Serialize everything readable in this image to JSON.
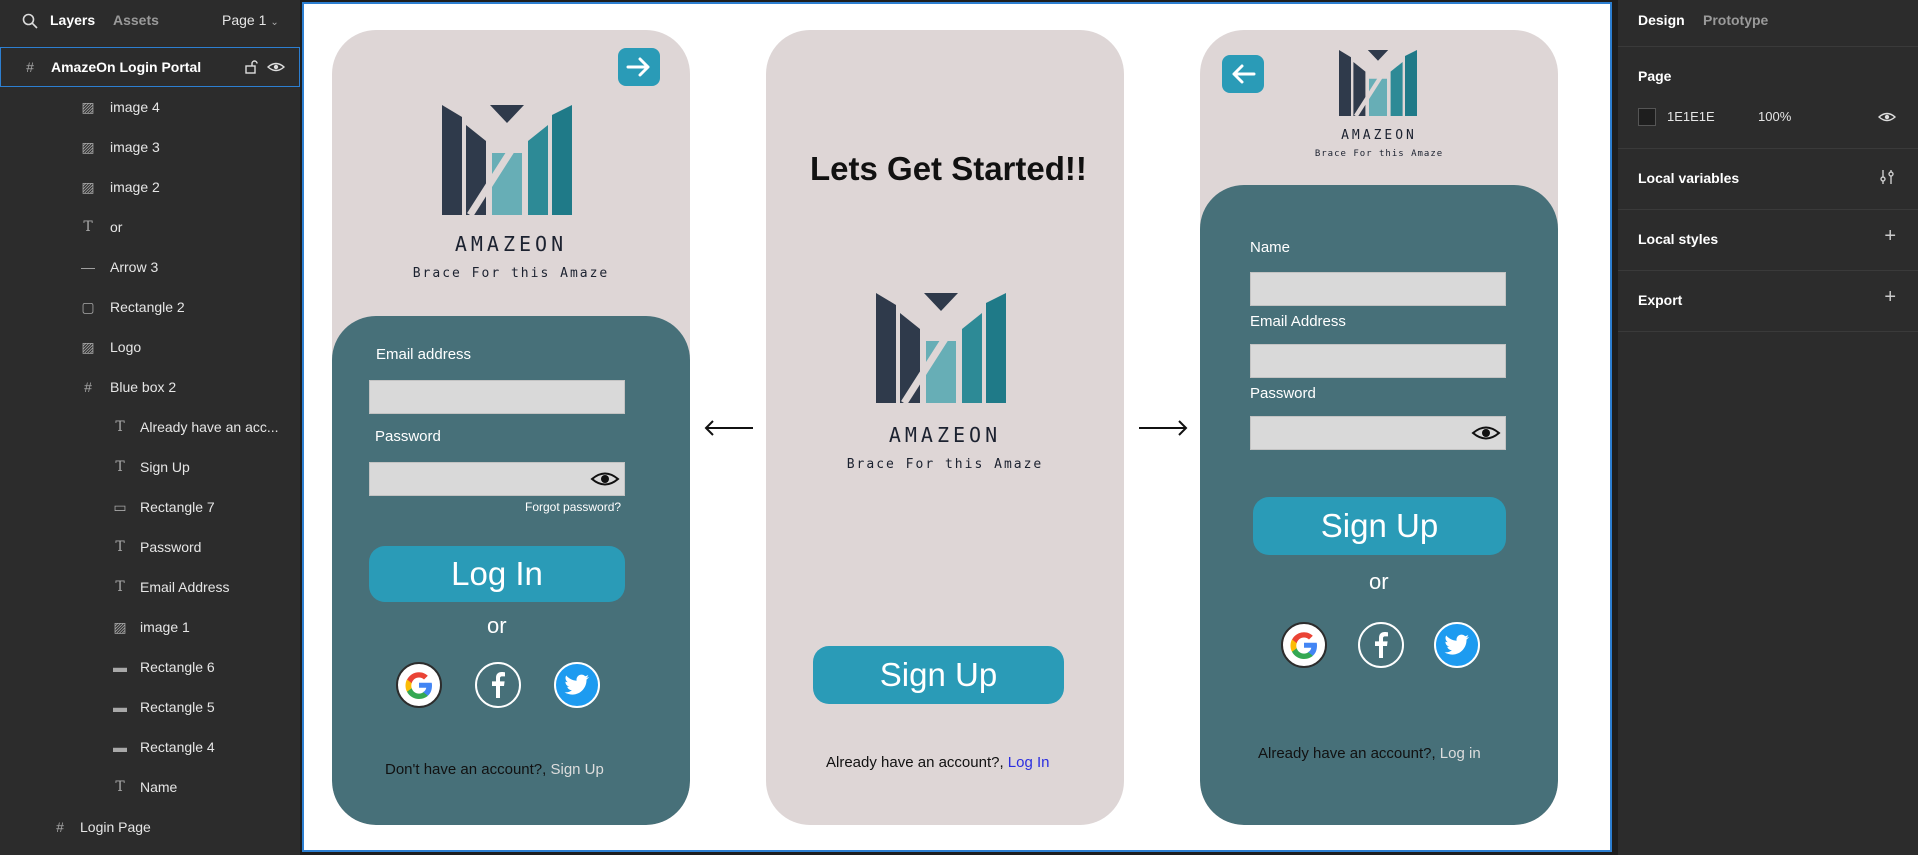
{
  "left_panel": {
    "tabs": {
      "layers": "Layers",
      "assets": "Assets"
    },
    "page_selector": "Page 1",
    "layers": [
      {
        "label": "AmazeOn Login Portal",
        "icon": "frame-icon",
        "selected": true
      },
      {
        "label": "image 4",
        "icon": "image-icon"
      },
      {
        "label": "image 3",
        "icon": "image-icon"
      },
      {
        "label": "image 2",
        "icon": "image-icon"
      },
      {
        "label": "or",
        "icon": "text-icon"
      },
      {
        "label": "Arrow 3",
        "icon": "line-icon"
      },
      {
        "label": "Rectangle 2",
        "icon": "rectangle-icon"
      },
      {
        "label": "Logo",
        "icon": "image-icon"
      },
      {
        "label": "Blue box 2",
        "icon": "frame-icon"
      },
      {
        "label": "Already have an acc...",
        "icon": "text-icon"
      },
      {
        "label": "Sign Up",
        "icon": "text-icon"
      },
      {
        "label": "Rectangle 7",
        "icon": "rectangle-icon"
      },
      {
        "label": "Password",
        "icon": "text-icon"
      },
      {
        "label": "Email Address",
        "icon": "text-icon"
      },
      {
        "label": "image 1",
        "icon": "image-icon"
      },
      {
        "label": "Rectangle 6",
        "icon": "rectangle-icon"
      },
      {
        "label": "Rectangle 5",
        "icon": "rectangle-icon"
      },
      {
        "label": "Rectangle 4",
        "icon": "rectangle-icon"
      },
      {
        "label": "Name",
        "icon": "text-icon"
      },
      {
        "label": "Login Page",
        "icon": "frame-icon"
      }
    ]
  },
  "canvas": {
    "logo": {
      "brand": "AMAZEON",
      "tagline": "Brace For this Amaze"
    },
    "login_screen": {
      "email_label": "Email address",
      "password_label": "Password",
      "forgot_password": "Forgot password?",
      "login_button": "Log In",
      "or_text": "or",
      "footer_prefix": "Don't have an account?,",
      "footer_link": "Sign Up"
    },
    "start_screen": {
      "headline": "Lets Get Started!!",
      "signup_button": "Sign Up",
      "footer_prefix": "Already have an account?,",
      "footer_link": "Log In"
    },
    "signup_screen": {
      "name_label": "Name",
      "email_label": "Email Address",
      "password_label": "Password",
      "signup_button": "Sign Up",
      "or_text": "or",
      "footer_prefix": "Already  have an account?,",
      "footer_link": "Log in"
    },
    "colors": {
      "card_bg": "#ded6d6",
      "panel_teal": "#477079",
      "button_blue": "#2a9bb7",
      "logo_dark": "#2f3a4b",
      "logo_teal": "#2d8a96"
    }
  },
  "right_panel": {
    "tabs": {
      "design": "Design",
      "prototype": "Prototype"
    },
    "page_heading": "Page",
    "page_color": "1E1E1E",
    "page_opacity": "100%",
    "sections": [
      "Local variables",
      "Local styles",
      "Export"
    ]
  }
}
